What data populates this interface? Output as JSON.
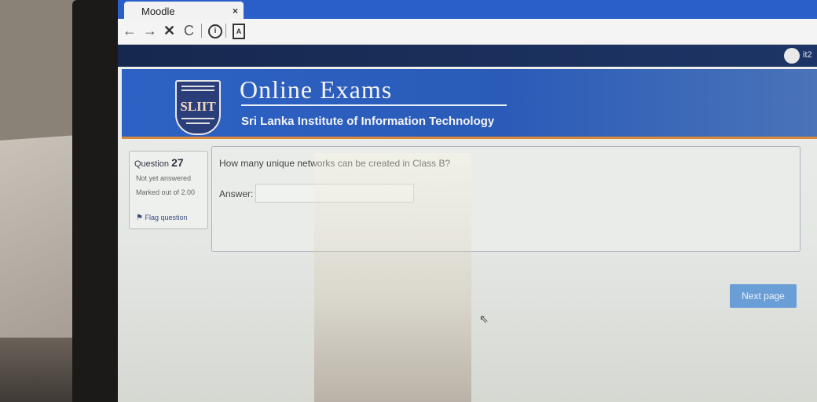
{
  "browser": {
    "tab_title": "Moodle",
    "tab_close": "×",
    "nav": {
      "back": "←",
      "forward": "→",
      "stop": "✕",
      "reload": "C"
    },
    "info_icon": "i",
    "reader_icon": "A"
  },
  "topbar": {
    "user_name": "it2"
  },
  "banner": {
    "title": "Online Exams",
    "subtitle": "Sri Lanka Institute of Information Technology",
    "logo_text": "SLIIT"
  },
  "question_info": {
    "label": "Question",
    "number": "27",
    "state": "Not yet answered",
    "grade": "Marked out of 2.00",
    "flag_label": "Flag question",
    "flag_icon": "flag-icon"
  },
  "question": {
    "text": "How many unique networks can be created in Class B?",
    "answer_label": "Answer:",
    "answer_value": ""
  },
  "navigation": {
    "next_label": "Next page"
  },
  "colors": {
    "tab_strip": "#2a5fc9",
    "top_bar": "#1d3566",
    "banner": "#2d62c4",
    "banner_accent": "#d9893a",
    "next_button": "#6a9ed6"
  }
}
